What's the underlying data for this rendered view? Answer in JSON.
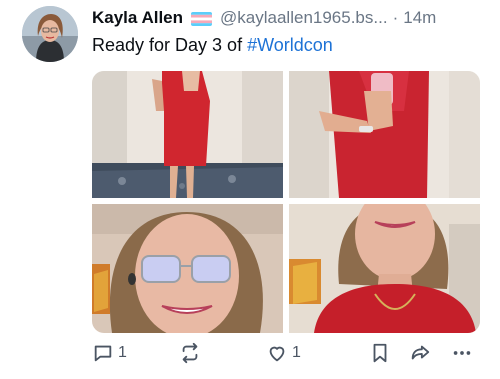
{
  "post": {
    "author_name": "Kayla Allen",
    "author_handle": "@kaylaallen1965.bs...",
    "separator": "·",
    "timestamp": "14m",
    "text_prefix": "Ready for Day 3 of ",
    "hashtag": "#Worldcon"
  },
  "media": {
    "images": [
      {
        "desc": "full length mirror selfie in red dress"
      },
      {
        "desc": "mirror selfie holding phone in red dress"
      },
      {
        "desc": "close-up selfie with glasses"
      },
      {
        "desc": "close-up selfie in red top"
      }
    ]
  },
  "actions": {
    "reply_count": "1",
    "like_count": "1"
  },
  "colors": {
    "hashtag": "#1d72d6",
    "dress_red": "#d0262f",
    "muted_text": "#6a7685",
    "icon": "#4b5563"
  },
  "icons": [
    "avatar",
    "trans-flag-icon",
    "reply-icon",
    "repost-icon",
    "like-icon",
    "bookmark-icon",
    "share-icon",
    "more-icon"
  ]
}
